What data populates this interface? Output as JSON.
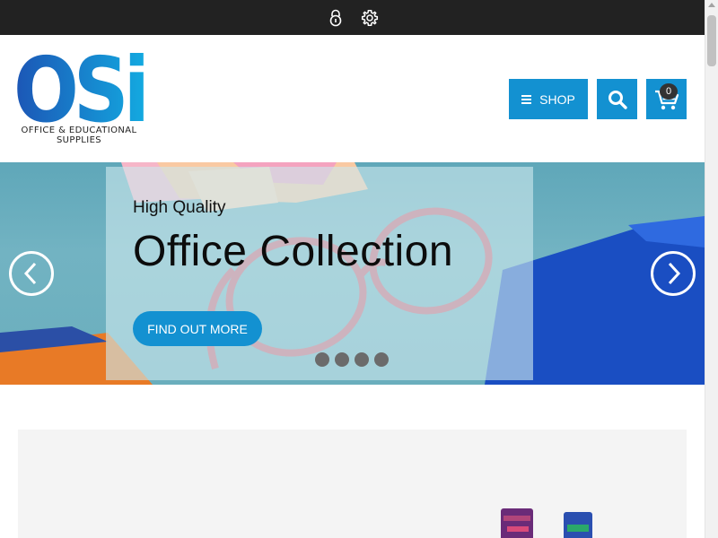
{
  "topbar": {
    "icons": [
      "lock-icon",
      "gear-icon"
    ]
  },
  "brand": {
    "logo_text": "OSi",
    "tagline_line1": "OFFICE & EDUCATIONAL",
    "tagline_line2": "SUPPLIES",
    "colors": {
      "logo_gradient_start": "#1c55b5",
      "logo_gradient_end": "#13a9e0"
    }
  },
  "header": {
    "shop_label": "SHOP",
    "cart_count": "0",
    "icons": [
      "menu-icon",
      "search-icon",
      "cart-icon"
    ]
  },
  "hero": {
    "eyebrow": "High Quality",
    "headline": "Office Collection",
    "cta_label": "FIND OUT MORE",
    "slide_count": 4,
    "nav_icons": [
      "chevron-left-icon",
      "chevron-right-icon"
    ]
  },
  "colors": {
    "accent": "#1391d1",
    "topbar": "#222222",
    "dot": "#6b6b6b"
  }
}
